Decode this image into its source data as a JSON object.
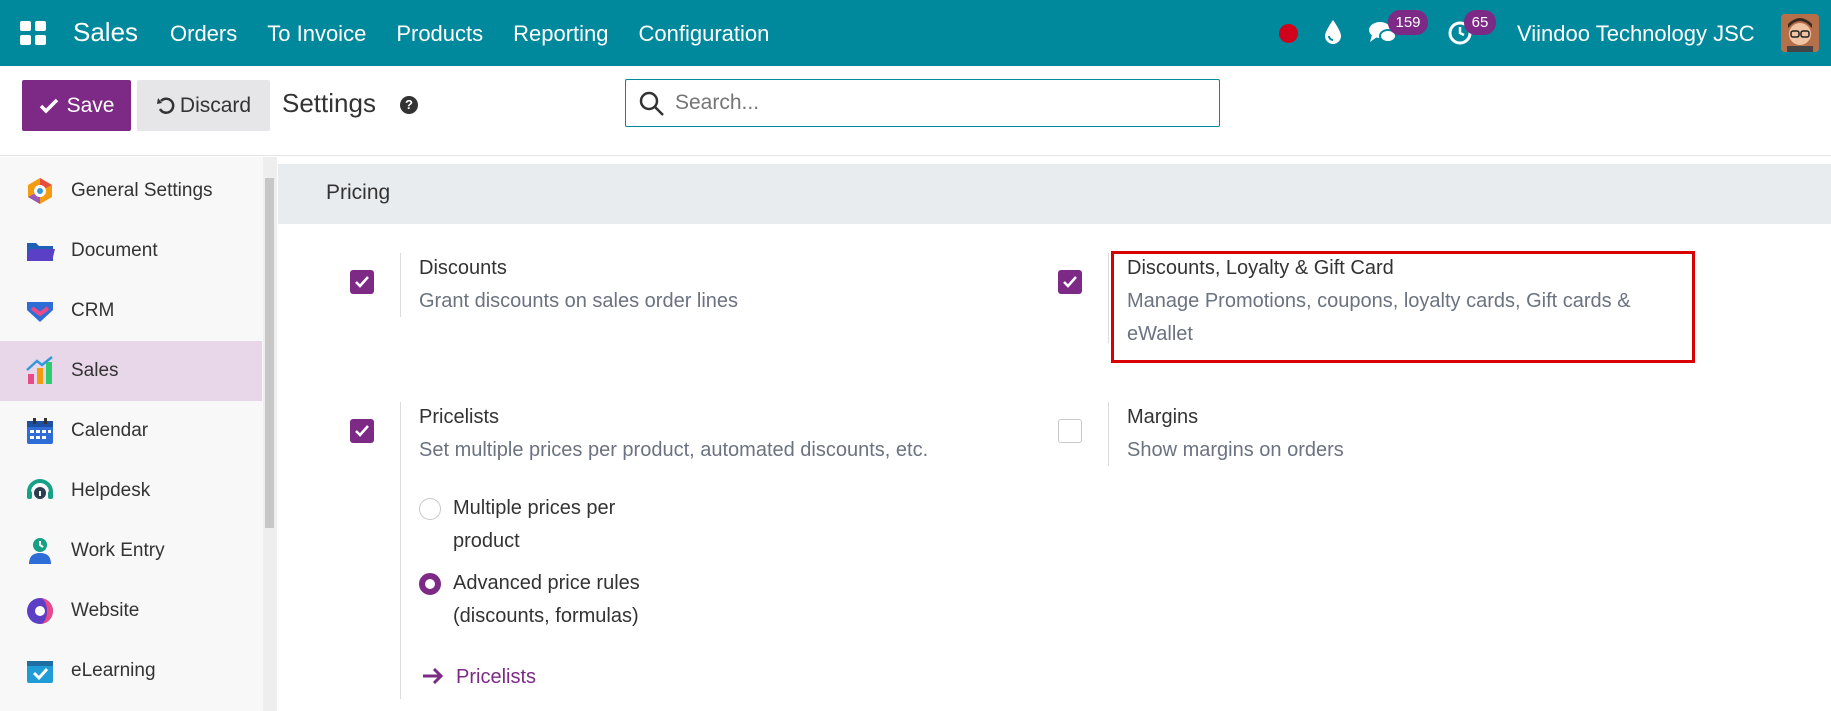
{
  "topbar": {
    "brand": "Sales",
    "menu": [
      "Orders",
      "To Invoice",
      "Products",
      "Reporting",
      "Configuration"
    ],
    "chat_count": "159",
    "activity_count": "65",
    "company": "Viindoo Technology JSC"
  },
  "control": {
    "save_label": "Save",
    "discard_label": "Discard",
    "title": "Settings",
    "help": "?",
    "search_placeholder": "Search..."
  },
  "sidebar": {
    "items": [
      {
        "label": "General Settings"
      },
      {
        "label": "Document"
      },
      {
        "label": "CRM"
      },
      {
        "label": "Sales"
      },
      {
        "label": "Calendar"
      },
      {
        "label": "Helpdesk"
      },
      {
        "label": "Work Entry"
      },
      {
        "label": "Website"
      },
      {
        "label": "eLearning"
      }
    ],
    "active": "Sales"
  },
  "pricing": {
    "section_title": "Pricing",
    "discounts": {
      "title": "Discounts",
      "desc": "Grant discounts on sales order lines",
      "checked": true
    },
    "loyalty": {
      "title": "Discounts, Loyalty & Gift Card",
      "desc_line1": "Manage Promotions, coupons, loyalty cards, Gift cards &",
      "desc_line2": "eWallet",
      "checked": true
    },
    "pricelists": {
      "title": "Pricelists",
      "desc": "Set multiple prices per product, automated discounts, etc.",
      "checked": true
    },
    "margins": {
      "title": "Margins",
      "desc": "Show margins on orders",
      "checked": false
    },
    "radio1_line1": "Multiple prices per",
    "radio1_line2": "product",
    "radio2_line1": "Advanced price rules",
    "radio2_line2": "(discounts, formulas)",
    "link": "Pricelists"
  },
  "colors": {
    "topbar": "#00889c",
    "accent": "#7d2a86",
    "highlight": "#d90000"
  }
}
